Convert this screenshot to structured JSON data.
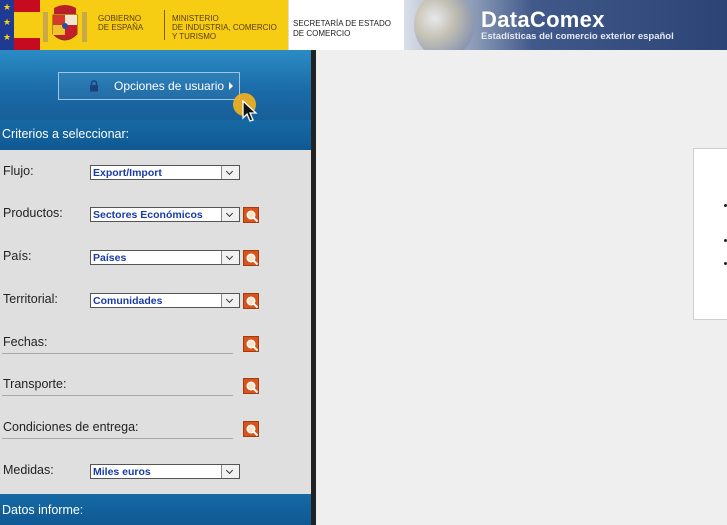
{
  "header": {
    "gov_name_line1": "GOBIERNO",
    "gov_name_line2": "DE ESPAÑA",
    "ministry_line1": "MINISTERIO",
    "ministry_line2": "DE INDUSTRIA, COMERCIO",
    "ministry_line3": "Y TURISMO",
    "secretaria_line1": "SECRETARÍA DE ESTADO",
    "secretaria_line2": "DE COMERCIO",
    "app_title": "DataComex",
    "app_subtitle": "Estadísticas del comercio exterior español"
  },
  "sidebar": {
    "user_options_label": "Opciones de usuario",
    "criteria_heading": "Criterios a seleccionar:",
    "report_heading": "Datos informe:",
    "criteria": [
      {
        "label": "Flujo:",
        "value": "Export/Import",
        "has_select": true,
        "has_search": false
      },
      {
        "label": "Productos:",
        "value": "Sectores Económicos",
        "has_select": true,
        "has_search": true
      },
      {
        "label": "País:",
        "value": "Países",
        "has_select": true,
        "has_search": true
      },
      {
        "label": "Territorial:",
        "value": "Comunidades",
        "has_select": true,
        "has_search": true
      },
      {
        "label": "Fechas:",
        "value": "",
        "has_select": false,
        "has_search": true
      },
      {
        "label": "Transporte:",
        "value": "",
        "has_select": false,
        "has_search": true
      },
      {
        "label": "Condiciones de entrega:",
        "value": "",
        "has_select": false,
        "has_search": true
      },
      {
        "label": "Medidas:",
        "value": "Miles euros",
        "has_select": true,
        "has_search": false
      }
    ]
  },
  "icons": {
    "lock": "lock-icon",
    "search": "search-icon",
    "dropdown": "chevron-down-icon",
    "cursor": "pointer-icon"
  },
  "colors": {
    "brand_blue": "#166aa5",
    "select_text": "#1a3aa6",
    "search_orange": "#d9541b",
    "gov_yellow": "#f7cd13"
  }
}
